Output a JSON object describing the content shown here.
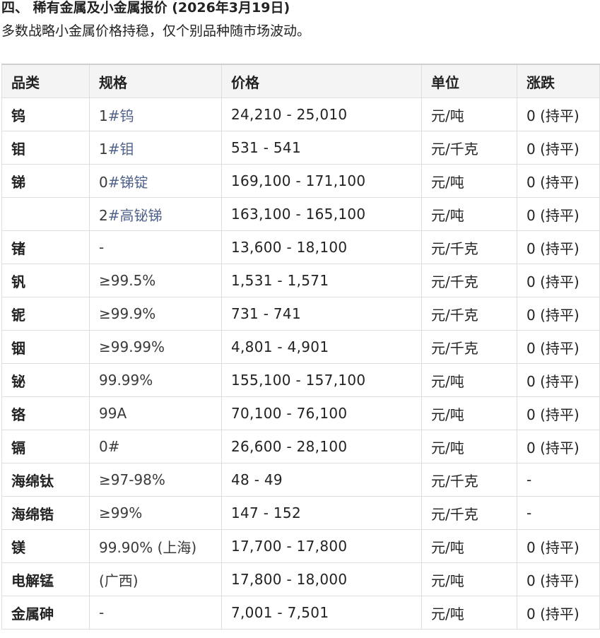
{
  "section": {
    "title": "四、 稀有金属及小金属报价 (2026年3月19日)",
    "subtitle": "多数战略小金属价格持稳，仅个别品种随市场波动。"
  },
  "table": {
    "headers": [
      "品类",
      "规格",
      "价格",
      "单位",
      "涨跌"
    ],
    "rows": [
      {
        "category": "钨",
        "spec_prefix": "1",
        "spec_link": "#钨",
        "price": "24,210 - 25,010",
        "unit": "元/吨",
        "change": "0 (持平)"
      },
      {
        "category": "钼",
        "spec_prefix": "1",
        "spec_link": "#钼",
        "price": "531 - 541",
        "unit": "元/千克",
        "change": "0 (持平)"
      },
      {
        "category": "锑",
        "spec_prefix": "0",
        "spec_link": "#锑锭",
        "price": "169,100 - 171,100",
        "unit": "元/吨",
        "change": "0 (持平)"
      },
      {
        "category": "",
        "spec_prefix": "2",
        "spec_link": "#高铋锑",
        "price": "163,100 - 165,100",
        "unit": "元/吨",
        "change": "0 (持平)"
      },
      {
        "category": "锗",
        "spec_prefix": "-",
        "spec_link": "",
        "price": "13,600 - 18,100",
        "unit": "元/千克",
        "change": "0 (持平)"
      },
      {
        "category": "钒",
        "spec_prefix": "≥99.5%",
        "spec_link": "",
        "price": "1,531 - 1,571",
        "unit": "元/千克",
        "change": "0 (持平)"
      },
      {
        "category": "铌",
        "spec_prefix": "≥99.9%",
        "spec_link": "",
        "price": "731 - 741",
        "unit": "元/千克",
        "change": "0 (持平)"
      },
      {
        "category": "铟",
        "spec_prefix": "≥99.99%",
        "spec_link": "",
        "price": "4,801 - 4,901",
        "unit": "元/千克",
        "change": "0 (持平)"
      },
      {
        "category": "铋",
        "spec_prefix": "99.99%",
        "spec_link": "",
        "price": "155,100 - 157,100",
        "unit": "元/吨",
        "change": "0 (持平)"
      },
      {
        "category": "铬",
        "spec_prefix": "99A",
        "spec_link": "",
        "price": "70,100 - 76,100",
        "unit": "元/吨",
        "change": "0 (持平)"
      },
      {
        "category": "镉",
        "spec_prefix": "0#",
        "spec_link": "",
        "price": "26,600 - 28,100",
        "unit": "元/吨",
        "change": "0 (持平)"
      },
      {
        "category": "海绵钛",
        "spec_prefix": "≥97-98%",
        "spec_link": "",
        "price": "48 - 49",
        "unit": "元/千克",
        "change": "-"
      },
      {
        "category": "海绵锆",
        "spec_prefix": "≥99%",
        "spec_link": "",
        "price": "147 - 152",
        "unit": "元/千克",
        "change": "-"
      },
      {
        "category": "镁",
        "spec_prefix": "99.90% (上海)",
        "spec_link": "",
        "price": "17,700 - 17,800",
        "unit": "元/吨",
        "change": "0 (持平)"
      },
      {
        "category": "电解锰",
        "spec_prefix": "(广西)",
        "spec_link": "",
        "price": "17,800 - 18,000",
        "unit": "元/吨",
        "change": "0 (持平)"
      },
      {
        "category": "金属砷",
        "spec_prefix": "-",
        "spec_link": "",
        "price": "7,001 - 7,501",
        "unit": "元/吨",
        "change": "0 (持平)"
      }
    ]
  }
}
